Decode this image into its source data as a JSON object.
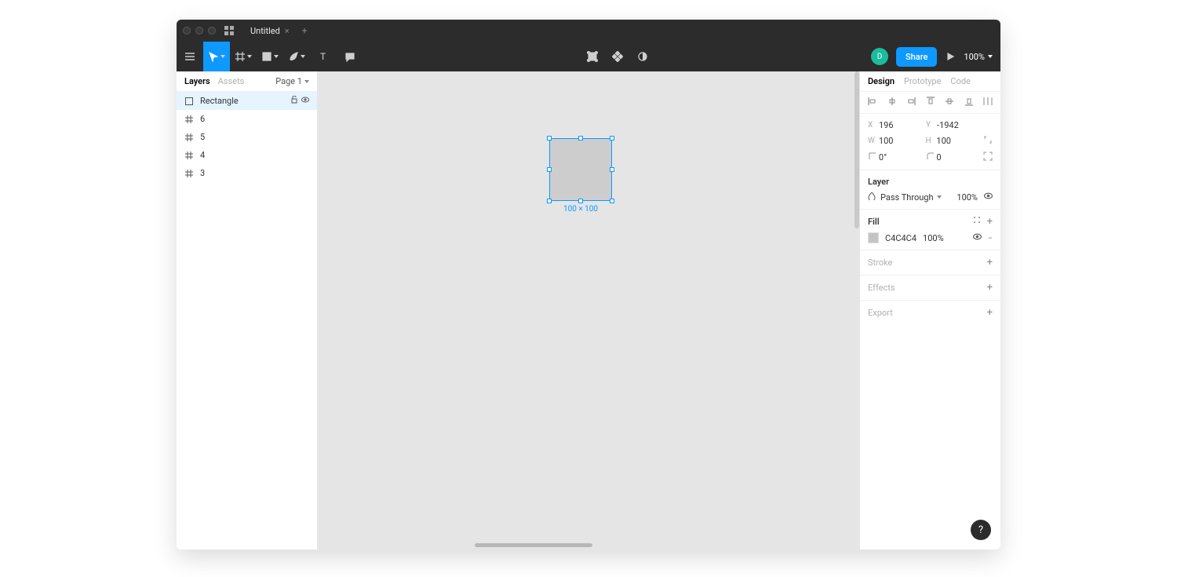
{
  "titlebar": {
    "tab_title": "Untitled"
  },
  "toolbar": {
    "avatar_initial": "D",
    "share_label": "Share",
    "zoom": "100%"
  },
  "left_panel": {
    "tabs": {
      "layers": "Layers",
      "assets": "Assets"
    },
    "page_label": "Page 1",
    "layers": [
      {
        "name": "Rectangle",
        "type": "rect",
        "selected": true
      },
      {
        "name": "6",
        "type": "frame",
        "selected": false
      },
      {
        "name": "5",
        "type": "frame",
        "selected": false
      },
      {
        "name": "4",
        "type": "frame",
        "selected": false
      },
      {
        "name": "3",
        "type": "frame",
        "selected": false
      }
    ]
  },
  "canvas": {
    "selection_label": "100 × 100"
  },
  "right_panel": {
    "tabs": {
      "design": "Design",
      "prototype": "Prototype",
      "code": "Code"
    },
    "position": {
      "x_label": "X",
      "x": "196",
      "y_label": "Y",
      "y": "-1942",
      "w_label": "W",
      "w": "100",
      "h_label": "H",
      "h": "100",
      "r_label": "⟀",
      "rotation": "0°",
      "c_label": "⌐",
      "corner": "0"
    },
    "layer_section": {
      "title": "Layer",
      "blend_mode": "Pass Through",
      "opacity": "100%"
    },
    "fill_section": {
      "title": "Fill",
      "hex": "C4C4C4",
      "opacity": "100%"
    },
    "stroke_section": {
      "title": "Stroke"
    },
    "effects_section": {
      "title": "Effects"
    },
    "export_section": {
      "title": "Export"
    }
  },
  "help_label": "?"
}
